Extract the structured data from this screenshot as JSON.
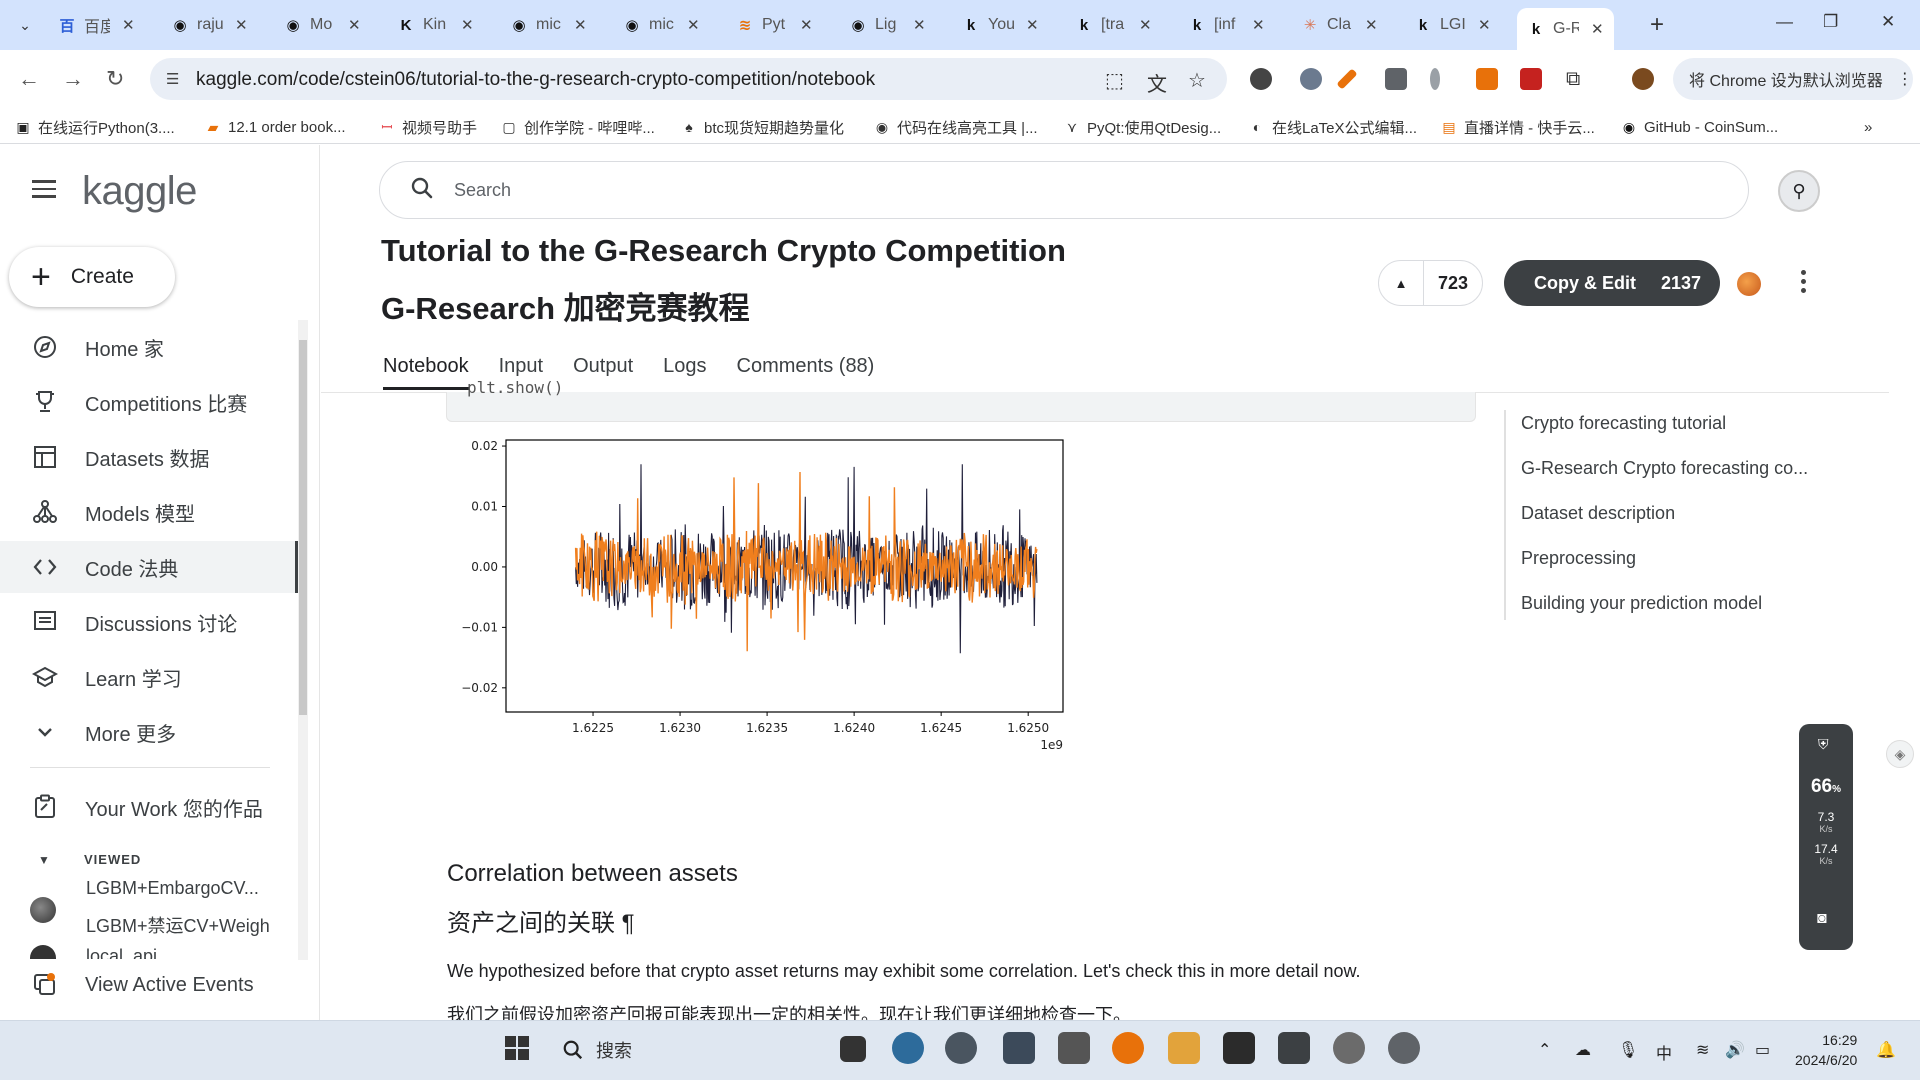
{
  "browser": {
    "tabs": [
      {
        "icon": "baidu-icon",
        "title": "百度"
      },
      {
        "icon": "github-icon",
        "title": "raju"
      },
      {
        "icon": "github-icon",
        "title": "Mo"
      },
      {
        "icon": "kimi-icon",
        "title": "Kin"
      },
      {
        "icon": "github-icon",
        "title": "mic"
      },
      {
        "icon": "github-icon",
        "title": "mic"
      },
      {
        "icon": "python-icon",
        "title": "Pyt"
      },
      {
        "icon": "github-icon",
        "title": "Lig"
      },
      {
        "icon": "kaggle-icon",
        "title": "You"
      },
      {
        "icon": "kaggle-icon",
        "title": "[tra"
      },
      {
        "icon": "kaggle-icon",
        "title": "[inf"
      },
      {
        "icon": "claude-icon",
        "title": "Cla"
      },
      {
        "icon": "kaggle-icon",
        "title": "LGI"
      },
      {
        "icon": "kaggle-icon",
        "title": "G-R"
      }
    ],
    "url": "kaggle.com/code/cstein06/tutorial-to-the-g-research-crypto-competition/notebook",
    "default_browser_label": "将 Chrome 设为默认浏览器",
    "bookmarks": [
      "在线运行Python(3....",
      "12.1 order book...",
      "视频号助手",
      "创作学院 - 哔哩哔...",
      "btc现货短期趋势量化",
      "代码在线高亮工具 |...",
      "PyQt:使用QtDesig...",
      "在线LaTeX公式编辑...",
      "直播详情 - 快手云...",
      "GitHub - CoinSum..."
    ]
  },
  "kaggle": {
    "logo": "kaggle",
    "create_label": "Create",
    "nav": [
      {
        "icon": "compass-icon",
        "label": "Home 家"
      },
      {
        "icon": "trophy-icon",
        "label": "Competitions 比赛"
      },
      {
        "icon": "table-icon",
        "label": "Datasets 数据"
      },
      {
        "icon": "models-icon",
        "label": "Models 模型"
      },
      {
        "icon": "code-icon",
        "label": "Code 法典"
      },
      {
        "icon": "discussion-icon",
        "label": "Discussions 讨论"
      },
      {
        "icon": "learn-icon",
        "label": "Learn 学习"
      },
      {
        "icon": "chevron-down-icon",
        "label": "More 更多"
      }
    ],
    "your_work": "Your Work 您的作品",
    "viewed_label": "VIEWED",
    "viewed_items": [
      "LGBM+EmbargoCV...",
      "LGBM+禁运CV+Weigh",
      "local_api"
    ],
    "view_active_events": "View Active Events",
    "search_placeholder": "Search"
  },
  "notebook": {
    "title_en": "Tutorial to the G-Research Crypto Competition",
    "title_zh": "G-Research 加密竞赛教程",
    "votes": "723",
    "copy_edit_label": "Copy & Edit",
    "copy_edit_count": "2137",
    "tabs": [
      "Notebook",
      "Input",
      "Output",
      "Logs",
      "Comments (88)"
    ],
    "code_snippet": "plt.show()",
    "toc": [
      "Crypto forecasting tutorial",
      "G-Research Crypto forecasting co...",
      "Dataset description",
      "Preprocessing",
      "Building your prediction model"
    ],
    "section_title_en": "Correlation between assets",
    "section_title_zh": "资产之间的关联 ¶",
    "para_en": "We hypothesized before that crypto asset returns may exhibit some correlation. Let's check this in more detail now.",
    "para_zh": "我们之前假设加密资产回报可能表现出一定的相关性。现在让我们更详细地检查一下。"
  },
  "chart_data": {
    "type": "line",
    "x_range": [
      1622000000,
      1625200000
    ],
    "x_offset_label": "1e9",
    "xticks": [
      "1.6225",
      "1.6230",
      "1.6235",
      "1.6240",
      "1.6245",
      "1.6250"
    ],
    "yticks": [
      "0.02",
      "0.01",
      "0.00",
      "−0.01",
      "−0.02"
    ],
    "ylim": [
      -0.024,
      0.021
    ],
    "series": [
      {
        "color": "#1f1f3a",
        "amplitude": 0.006,
        "spikes": 0.017
      },
      {
        "color": "#f07f1e",
        "amplitude": 0.005,
        "spikes": 0.016
      }
    ]
  },
  "speed_widget": {
    "percent": "66",
    "rate1": "7.3",
    "rate2": "17.4",
    "unit": "K/s"
  },
  "taskbar": {
    "search_label": "搜索",
    "time": "16:29",
    "date": "2024/6/20",
    "ime": "中"
  }
}
